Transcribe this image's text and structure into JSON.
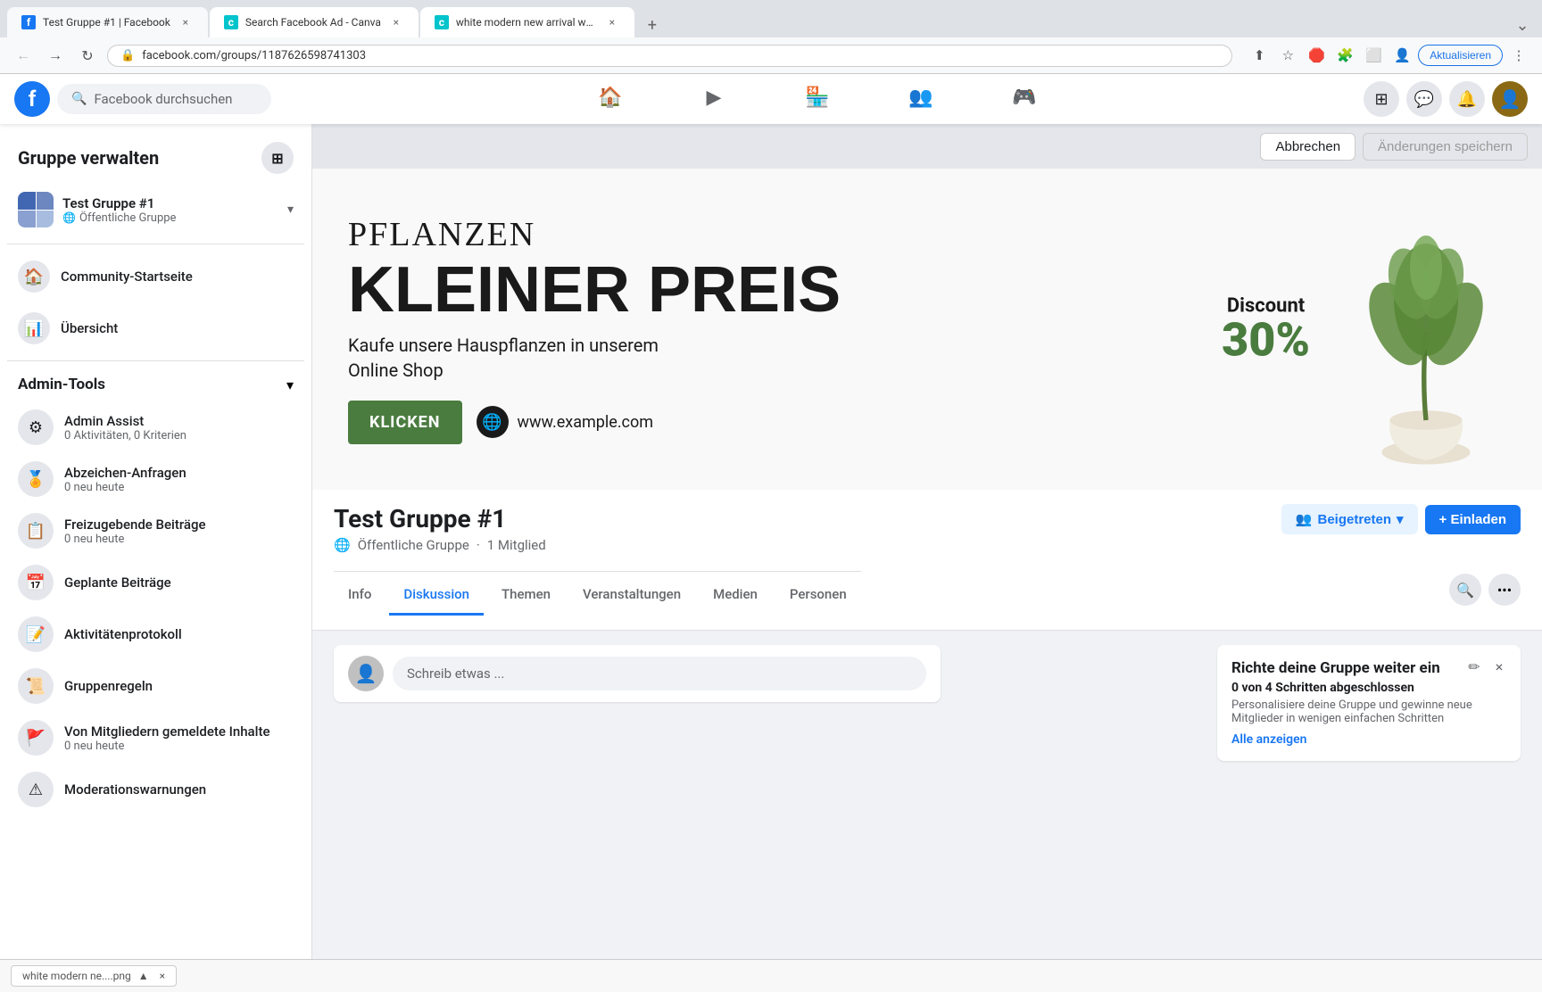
{
  "browser": {
    "tabs": [
      {
        "id": "tab1",
        "title": "Test Gruppe #1 | Facebook",
        "favicon_color": "#1877f2",
        "favicon_letter": "f",
        "active": true
      },
      {
        "id": "tab2",
        "title": "Search Facebook Ad - Canva",
        "favicon_color": "#00C4CC",
        "favicon_letter": "c",
        "active": false
      },
      {
        "id": "tab3",
        "title": "white modern new arrival watc...",
        "favicon_color": "#00C4CC",
        "favicon_letter": "c",
        "active": false
      }
    ],
    "url": "facebook.com/groups/1187626598741303",
    "update_btn_label": "Aktualisieren"
  },
  "fb_header": {
    "search_placeholder": "Facebook durchsuchen",
    "nav_items": [
      {
        "id": "home",
        "icon": "🏠",
        "active": false
      },
      {
        "id": "video",
        "icon": "▶",
        "active": false
      },
      {
        "id": "marketplace",
        "icon": "🏪",
        "active": false
      },
      {
        "id": "groups",
        "icon": "👥",
        "active": false
      },
      {
        "id": "gaming",
        "icon": "🎮",
        "active": false
      }
    ]
  },
  "sidebar": {
    "title": "Gruppe verwalten",
    "group_name": "Test Gruppe #1",
    "group_type": "Öffentliche Gruppe",
    "nav_items": [
      {
        "id": "community",
        "label": "Community-Startseite",
        "icon": "🏠"
      },
      {
        "id": "overview",
        "label": "Übersicht",
        "icon": "📊"
      }
    ],
    "admin_tools": {
      "title": "Admin-Tools",
      "items": [
        {
          "id": "admin-assist",
          "label": "Admin Assist",
          "sub": "0 Aktivitäten, 0 Kriterien"
        },
        {
          "id": "badge-requests",
          "label": "Abzeichen-Anfragen",
          "sub": "0 neu heute"
        },
        {
          "id": "pending-posts",
          "label": "Freizugebende Beiträge",
          "sub": "0 neu heute"
        },
        {
          "id": "scheduled",
          "label": "Geplante Beiträge",
          "sub": ""
        },
        {
          "id": "activity-log",
          "label": "Aktivitätenprotokoll",
          "sub": ""
        },
        {
          "id": "group-rules",
          "label": "Gruppenregeln",
          "sub": ""
        },
        {
          "id": "reported",
          "label": "Von Mitgliedern gemeldete Inhalte",
          "sub": "0 neu heute"
        },
        {
          "id": "moderation",
          "label": "Moderationswarnungen",
          "sub": ""
        }
      ]
    }
  },
  "cover": {
    "cancel_btn": "Abbrechen",
    "save_btn": "Änderungen speichern"
  },
  "ad": {
    "title_small": "PFLANZEN",
    "title_big": "KLEINER PREIS",
    "subtitle_line1": "Kaufe unsere Hauspflanzen in unserem",
    "subtitle_line2": "Online Shop",
    "cta_btn": "KLICKEN",
    "website": "www.example.com",
    "discount_label": "Discount",
    "discount_pct": "30%"
  },
  "group": {
    "name": "Test Gruppe #1",
    "type": "Öffentliche Gruppe",
    "separator": "·",
    "member_count": "1 Mitglied",
    "tabs": [
      {
        "id": "info",
        "label": "Info",
        "active": false
      },
      {
        "id": "discussion",
        "label": "Diskussion",
        "active": true
      },
      {
        "id": "themes",
        "label": "Themen",
        "active": false
      },
      {
        "id": "events",
        "label": "Veranstaltungen",
        "active": false
      },
      {
        "id": "media",
        "label": "Medien",
        "active": false
      },
      {
        "id": "people",
        "label": "Personen",
        "active": false
      }
    ],
    "joined_btn": "Beigetreten",
    "invite_btn": "+ Einladen"
  },
  "post_box": {
    "placeholder": "Schreib etwas ..."
  },
  "setup_panel": {
    "title": "Richte deine Gruppe weiter ein",
    "progress": "0 von 4",
    "steps_label": "Schritten abgeschlossen",
    "description": "Personalisiere deine Gruppe und gewinne neue Mitglieder in wenigen einfachen Schritten",
    "show_all_link": "Alle anzeigen"
  },
  "bottom_bar": {
    "download_name": "white modern ne....png",
    "chevron": "▲"
  }
}
